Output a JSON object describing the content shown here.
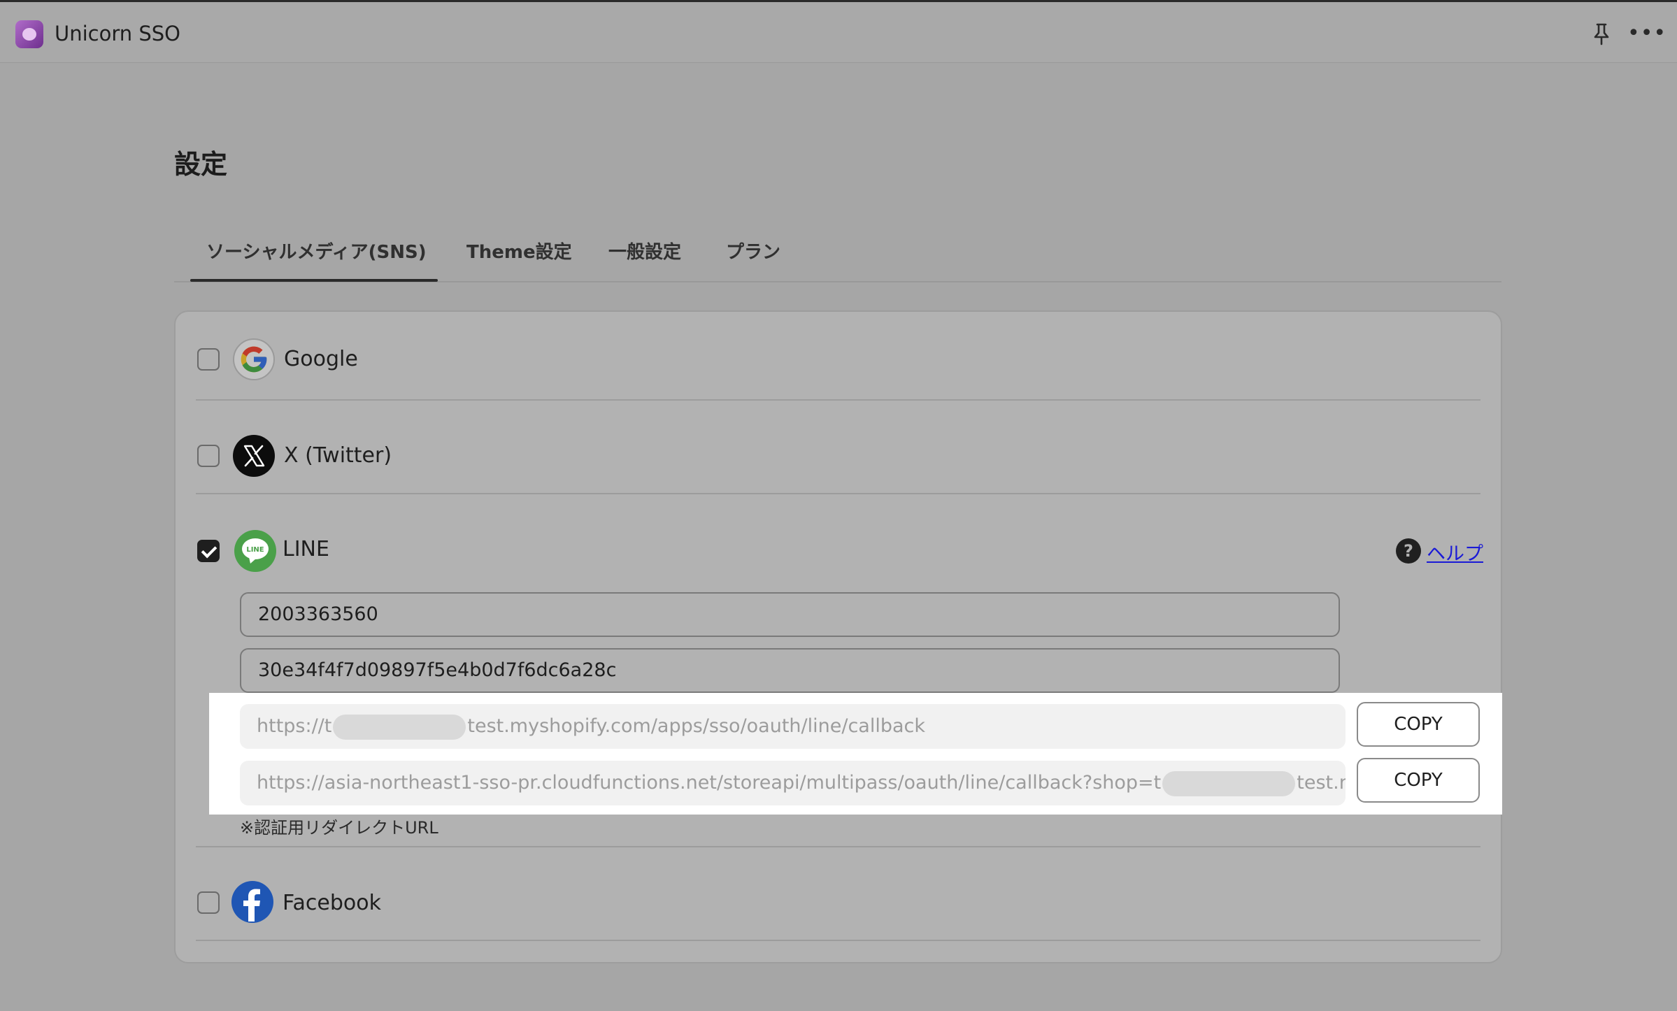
{
  "app": {
    "title": "Unicorn SSO"
  },
  "page": {
    "title": "設定"
  },
  "tabs": [
    {
      "label": "ソーシャルメディア(SNS)",
      "active": true
    },
    {
      "label": "Theme設定",
      "active": false
    },
    {
      "label": "一般設定",
      "active": false
    },
    {
      "label": "プラン",
      "active": false
    }
  ],
  "providers": {
    "google": {
      "label": "Google",
      "checked": false,
      "icon": "google-icon"
    },
    "x": {
      "label": "X (Twitter)",
      "checked": false,
      "icon": "x-icon"
    },
    "line": {
      "label": "LINE",
      "checked": true,
      "icon": "line-icon",
      "help_label": "ヘルプ",
      "channel_id": "2003363560",
      "channel_secret": "30e34f4f7d09897f5e4b0d7f6dc6a28c",
      "callback_url_1": {
        "prefix": "https://t",
        "suffix": "test.myshopify.com/apps/sso/oauth/line/callback"
      },
      "callback_url_2": {
        "prefix": "https://asia-northeast1-sso-pr.cloudfunctions.net/storeapi/multipass/oauth/line/callback?shop=t",
        "suffix": "test.myshopif"
      },
      "copy_label": "COPY",
      "note": "※認証用リダイレクトURL"
    },
    "facebook": {
      "label": "Facebook",
      "checked": false,
      "icon": "facebook-icon"
    }
  },
  "colors": {
    "help_link": "#1a1ad6",
    "line_green": "#4aa049",
    "facebook_blue": "#1f56b4"
  }
}
